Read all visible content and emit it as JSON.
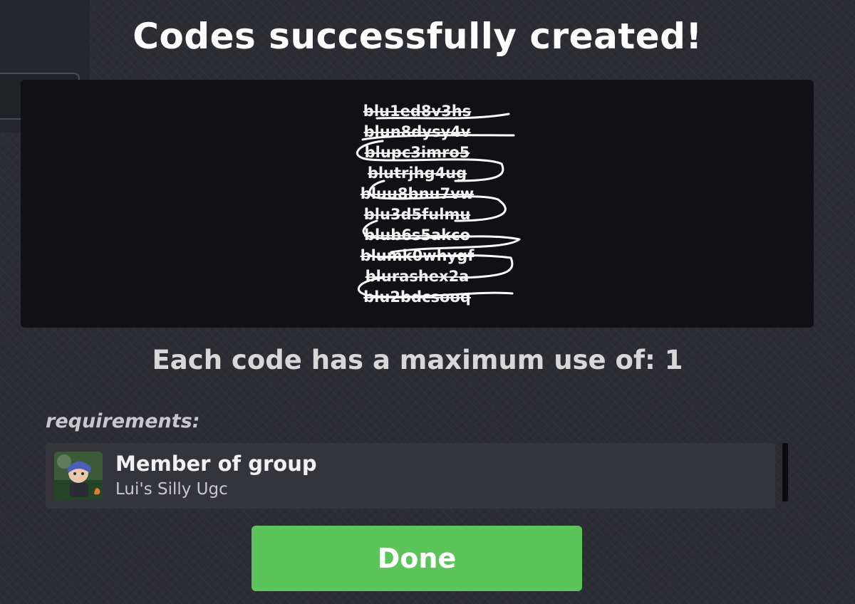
{
  "header": {
    "title": "Codes successfully created!"
  },
  "codes": [
    "blu1ed8v3hs",
    "blun8dysy4v",
    "blupc3imro5",
    "blutrjhg4ug",
    "bluu8bnu7vw",
    "blu3d5fulmu",
    "blub6s5akco",
    "blumk0whygf",
    "blurashex2a",
    "blu2bdcsooq"
  ],
  "usage": {
    "text": "Each code has a maximum use of: 1"
  },
  "requirements": {
    "label": "requirements:",
    "items": [
      {
        "title": "Member of group",
        "subtitle": "Lui's Silly Ugc"
      }
    ]
  },
  "actions": {
    "done_label": "Done"
  },
  "colors": {
    "background": "#2c2d33",
    "panel": "#111115",
    "accent_green": "#5cc45a"
  },
  "icons": {
    "share": "paper-plane-icon",
    "avatar": "group-avatar-image"
  }
}
